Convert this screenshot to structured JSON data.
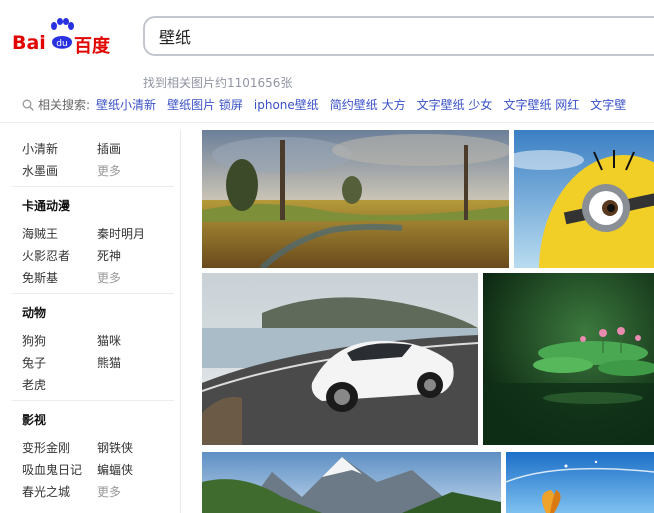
{
  "brand": {
    "name_left": "Bai",
    "name_paw": "du",
    "name_right": "百度"
  },
  "search": {
    "query": "壁纸"
  },
  "result_count": "找到相关图片约1101656张",
  "related": {
    "label": "相关搜索:",
    "links": [
      "壁纸小清新",
      "壁纸图片 锁屏",
      "iphone壁纸",
      "简约壁纸 大方",
      "文字壁纸 少女",
      "文字壁纸 网红",
      "文字壁"
    ]
  },
  "sidebar": {
    "group1": {
      "items": [
        "小清新",
        "插画",
        "水墨画",
        "更多"
      ]
    },
    "group2": {
      "title": "卡通动漫",
      "items": [
        "海贼王",
        "秦时明月",
        "火影忍者",
        "死神",
        "免斯基",
        "更多"
      ]
    },
    "group3": {
      "title": "动物",
      "items": [
        "狗狗",
        "猫咪",
        "兔子",
        "熊猫",
        "老虎"
      ]
    },
    "group4": {
      "title": "影视",
      "items": [
        "变形金刚",
        "钢铁侠",
        "吸血鬼日记",
        "蝙蝠侠",
        "春光之城",
        "更多"
      ]
    }
  },
  "images": [
    {
      "name": "fantasy-landscape-thumbnail"
    },
    {
      "name": "minion-thumbnail"
    },
    {
      "name": "white-sports-car-thumbnail"
    },
    {
      "name": "lotus-pond-thumbnail"
    },
    {
      "name": "mountain-thumbnail"
    },
    {
      "name": "butterfly-sky-thumbnail"
    }
  ],
  "colors": {
    "brand_red": "#e10602",
    "brand_blue": "#2932e1",
    "link_blue": "#3950c8"
  }
}
